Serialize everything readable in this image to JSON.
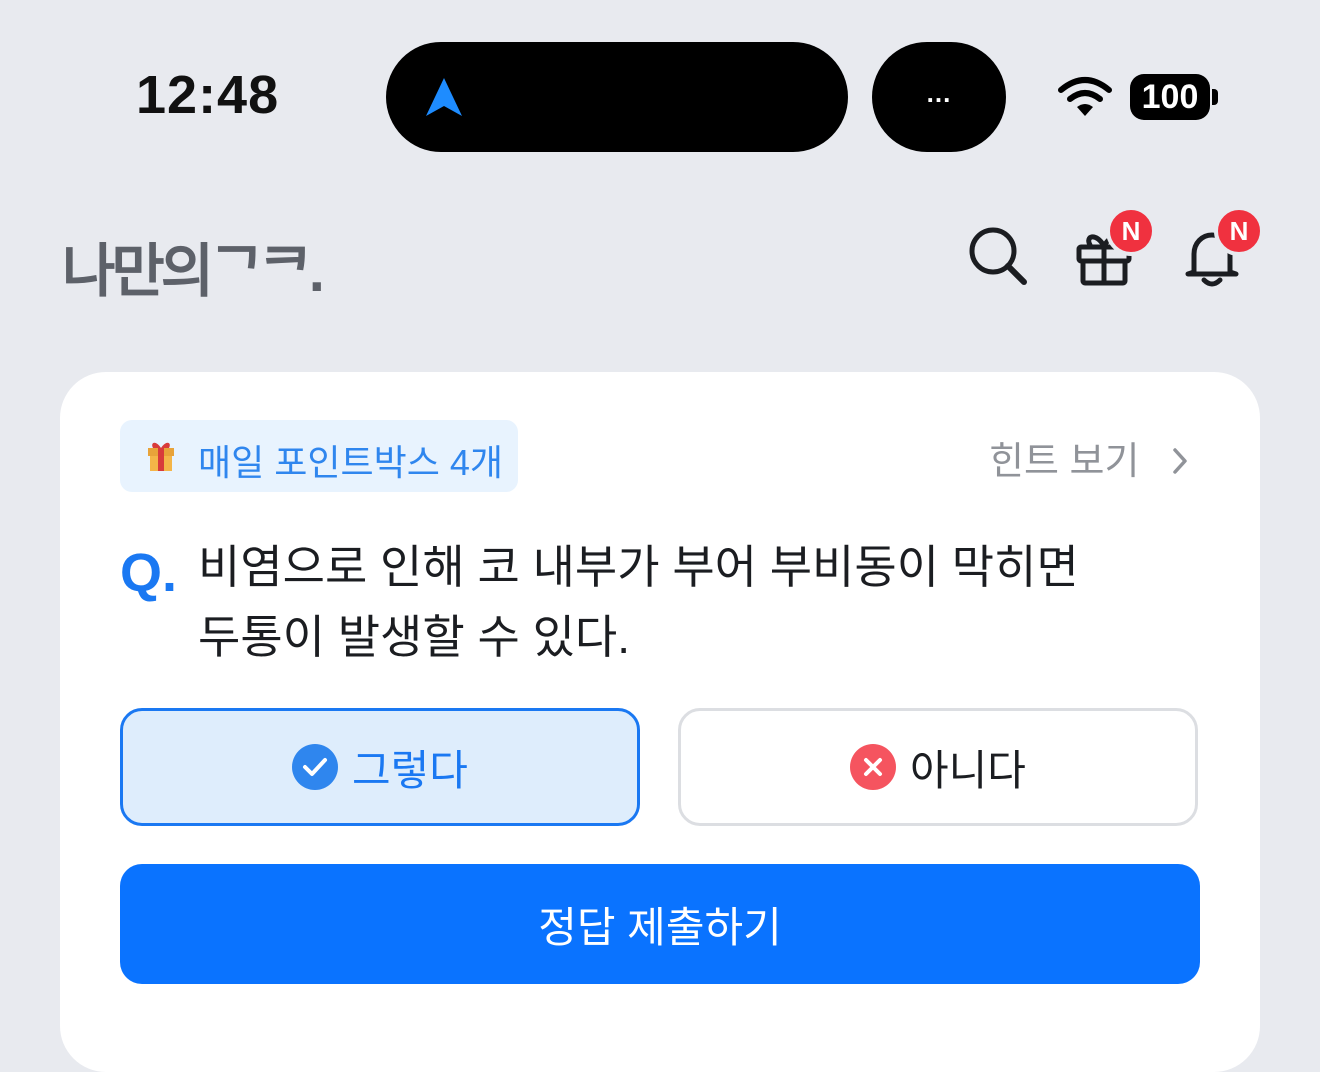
{
  "status_bar": {
    "time": "12:48",
    "island_more": "...",
    "battery": "100"
  },
  "header": {
    "logo": "나만의ᄀᄏ.",
    "gift_badge": "N",
    "bell_badge": "N"
  },
  "quiz": {
    "points_label": "매일 포인트박스 4개",
    "hint_label": "힌트 보기",
    "question_prefix": "Q.",
    "question": "비염으로 인해 코 내부가 부어 부비동이 막히면 두통이 발생할 수 있다.",
    "answers": [
      {
        "label": "그렇다",
        "selected": true
      },
      {
        "label": "아니다",
        "selected": false
      }
    ],
    "submit_label": "정답 제출하기"
  },
  "colors": {
    "accent": "#0a73ff",
    "badge": "#f0313f",
    "background": "#e8eaef"
  }
}
